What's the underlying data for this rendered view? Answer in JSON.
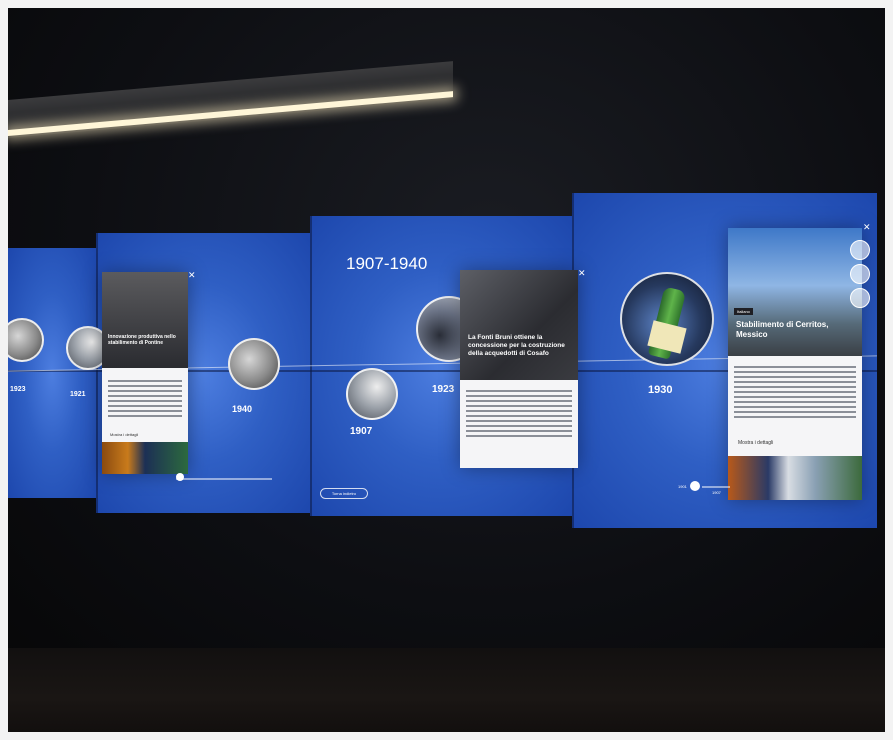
{
  "timeline": {
    "period": "1907-1940",
    "years": [
      "1923",
      "1921",
      "1940",
      "1907",
      "1923",
      "1930"
    ],
    "back_label": "Torna indietro",
    "nav": {
      "left": "1901",
      "right": "1907"
    }
  },
  "card_left": {
    "title": "Innovazione produttiva nello stabilimento di Pontine",
    "more": "Mostra i dettagli"
  },
  "card_center": {
    "title": "La Fonti Bruni ottiene la concessione per la costruzione della acquedotti di Cosafo"
  },
  "card_right": {
    "tag": "Italiano",
    "title": "Stabilimento di Cerritos, Messico",
    "more": "Mostra i dettagli"
  },
  "icons": [
    "close-icon",
    "share-icon",
    "zoom-icon",
    "info-icon"
  ]
}
